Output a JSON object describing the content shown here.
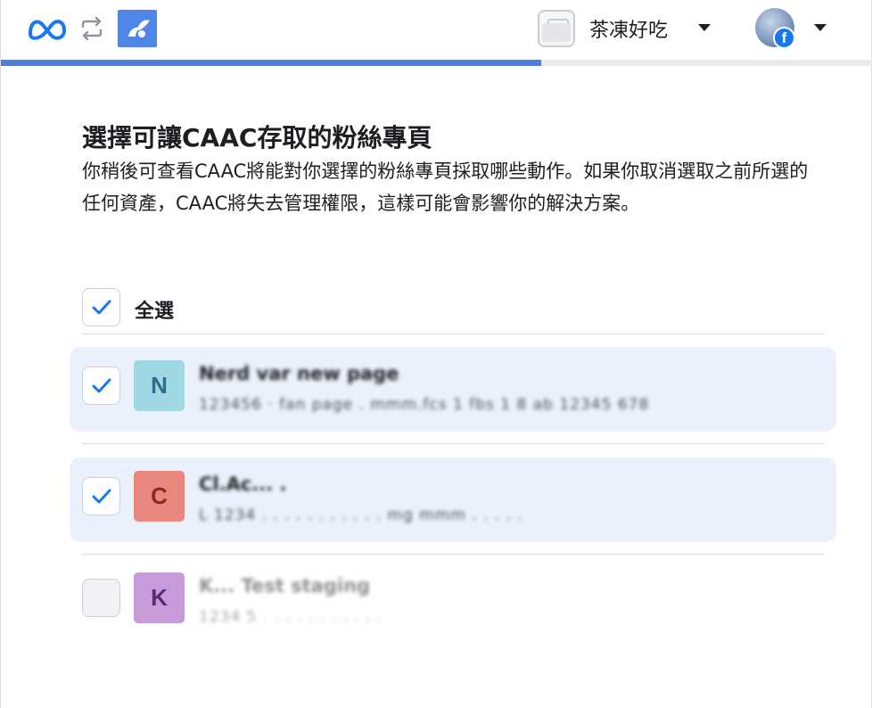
{
  "topbar": {
    "business_name": "茶凍好吃",
    "facebook_badge": "f"
  },
  "progress": {
    "fraction": 0.62
  },
  "main": {
    "title": "選擇可讓CAAC存取的粉絲專頁",
    "description": "你稍後可查看CAAC將能對你選擇的粉絲專頁採取哪些動作。如果你取消選取之前所選的任何資產，CAAC將失去管理權限，這樣可能會影響你的解決方案。",
    "select_all_label": "全選",
    "select_all_checked": true
  },
  "pages": [
    {
      "initial": "N",
      "name": "Nerd var new page",
      "meta": "123456 · fan page . mmm.fcs 1 fbs 1 8 ab 12345 678",
      "checked": true,
      "avatar_bg": "#9fd7e3",
      "avatar_fg": "#2b6f8a"
    },
    {
      "initial": "C",
      "name": "Cl.Ac... .",
      "meta": "L 1234  . . . . . . . . . . . mg mmm . . . . .",
      "checked": true,
      "avatar_bg": "#e8887c",
      "avatar_fg": "#8a2a26"
    },
    {
      "initial": "K",
      "name": "K... Test staging",
      "meta": "1234 5 . . . . . . . . . . .",
      "checked": false,
      "avatar_bg": "#c99ad9",
      "avatar_fg": "#5a2a72"
    }
  ],
  "colors": {
    "accent": "#1877f2",
    "progress": "#4c7fdc",
    "selected_row": "#ebf1fc",
    "check": "#1877f2"
  },
  "icons": [
    "meta-logo-icon",
    "swap-icon",
    "app-icon",
    "briefcase-icon",
    "chevron-down-icon",
    "facebook-icon",
    "check-icon"
  ]
}
